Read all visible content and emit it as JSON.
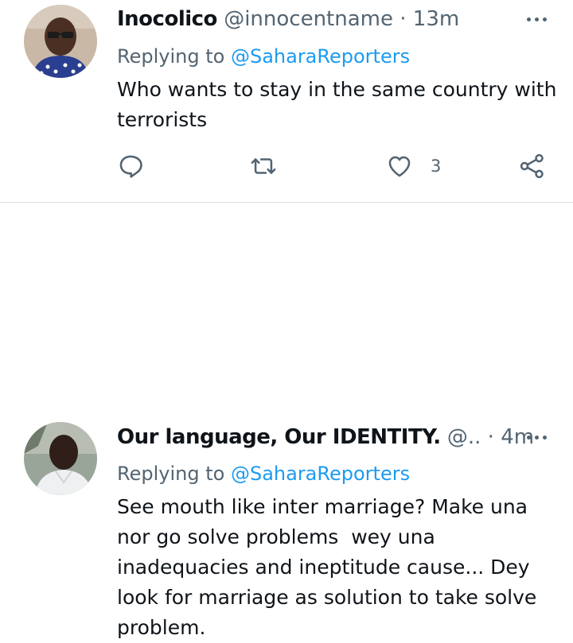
{
  "tweets": [
    {
      "name": "Inocolico",
      "handle": "@innocentname",
      "separator": "·",
      "time": "13m",
      "replying_prefix": "Replying to",
      "replying_to": "@SaharaReporters",
      "text_lines": [
        "Who wants to stay in the same country with",
        "terrorists"
      ],
      "like_count": "3",
      "avatar_icon": "user-avatar-photo"
    },
    {
      "name": "Our language, Our IDENTITY.",
      "handle": "@..",
      "separator": "·",
      "time": "4m",
      "replying_prefix": "Replying to",
      "replying_to": "@SaharaReporters",
      "text_lines": [
        "See mouth like inter marriage? Make una",
        "nor go solve problems  wey una",
        "inadequacies and ineptitude cause... Dey",
        "look for marriage as solution to take solve",
        "problem."
      ],
      "avatar_icon": "user-avatar-photo"
    }
  ],
  "icons": {
    "reply": "reply-icon",
    "retweet": "retweet-icon",
    "like": "heart-icon",
    "share": "share-icon",
    "more": "more-icon"
  },
  "colors": {
    "text": "#0f1419",
    "secondary": "#536471",
    "link": "#1d9bf0",
    "divider": "#dde3e8"
  }
}
